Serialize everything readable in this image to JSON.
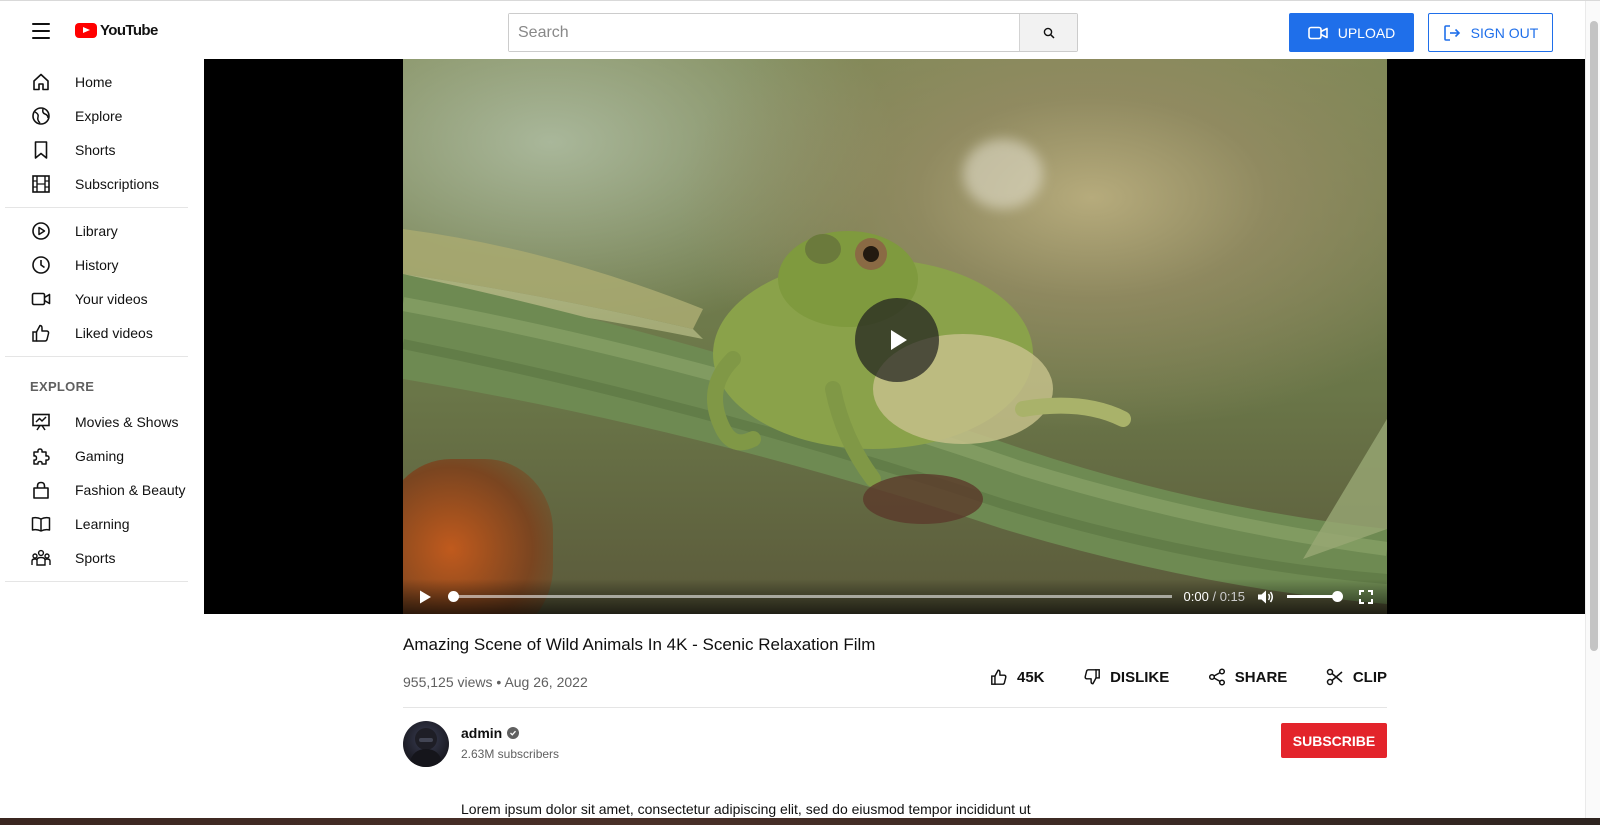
{
  "header": {
    "logo_text": "YouTube",
    "search_placeholder": "Search",
    "upload_label": "UPLOAD",
    "signout_label": "SIGN OUT",
    "accent_color": "#1f6fea"
  },
  "sidebar": {
    "main": [
      {
        "label": "Home",
        "icon": "home-icon"
      },
      {
        "label": "Explore",
        "icon": "compass-icon"
      },
      {
        "label": "Shorts",
        "icon": "bookmark-icon"
      },
      {
        "label": "Subscriptions",
        "icon": "film-icon"
      }
    ],
    "library": [
      {
        "label": "Library",
        "icon": "play-circle-icon"
      },
      {
        "label": "History",
        "icon": "clock-icon"
      },
      {
        "label": "Your videos",
        "icon": "video-icon"
      },
      {
        "label": "Liked videos",
        "icon": "thumbs-up-icon"
      }
    ],
    "explore_title": "EXPLORE",
    "explore": [
      {
        "label": "Movies & Shows",
        "icon": "presentation-icon"
      },
      {
        "label": "Gaming",
        "icon": "puzzle-icon"
      },
      {
        "label": "Fashion & Beauty",
        "icon": "shopping-bag-icon"
      },
      {
        "label": "Learning",
        "icon": "book-icon"
      },
      {
        "label": "Sports",
        "icon": "people-icon"
      }
    ]
  },
  "player": {
    "current_time": "0:00",
    "separator": " / ",
    "duration": "0:15",
    "progress_fraction": 0.0,
    "volume_fraction": 1.0
  },
  "video": {
    "title": "Amazing Scene of Wild Animals In 4K - Scenic Relaxation Film",
    "views": "955,125 views",
    "date": "Aug 26, 2022",
    "like_count": "45K",
    "dislike_label": "DISLIKE",
    "share_label": "SHARE",
    "clip_label": "CLIP"
  },
  "channel": {
    "name": "admin",
    "subscribers": "2.63M subscribers",
    "subscribe_label": "SUBSCRIBE",
    "subscribe_color": "#e3242b"
  },
  "description": "Lorem ipsum dolor sit amet, consectetur adipiscing elit, sed do eiusmod tempor incididunt ut"
}
